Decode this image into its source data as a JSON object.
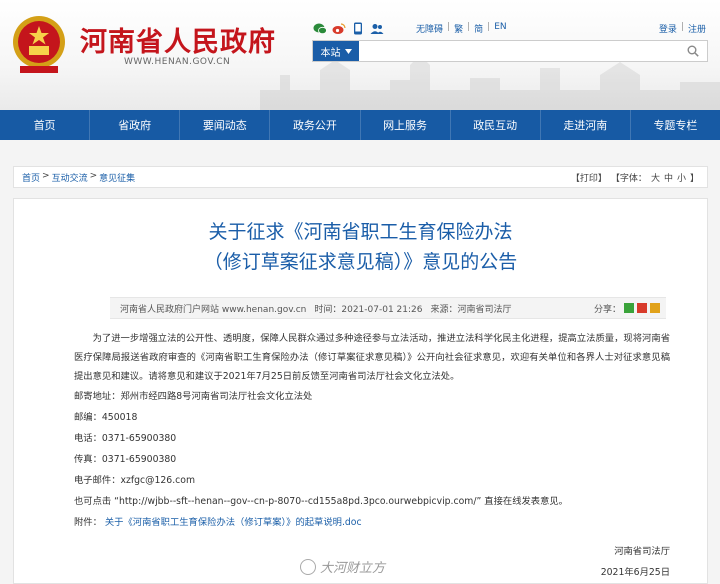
{
  "header": {
    "site_title": "河南省人民政府",
    "site_url": "WWW.HENAN.GOV.CN",
    "icons": [
      "wechat-icon",
      "weibo-icon",
      "mobile-icon",
      "people-icon"
    ],
    "top_links": [
      "无障碍",
      "繁",
      "简",
      "EN"
    ],
    "login": "登录",
    "register": "注册",
    "search": {
      "scope": "本站",
      "placeholder": ""
    }
  },
  "nav": {
    "items": [
      "首页",
      "省政府",
      "要闻动态",
      "政务公开",
      "网上服务",
      "政民互动",
      "走进河南",
      "专题专栏"
    ]
  },
  "breadcrumb": {
    "home": "首页",
    "section": "互动交流",
    "current": "意见征集",
    "print": "【打印】",
    "font_label": "【字体：",
    "font_large": "大",
    "font_medium": "中",
    "font_small": "小",
    "font_end": "】"
  },
  "article": {
    "title_line1": "关于征求《河南省职工生育保险办法",
    "title_line2": "（修订草案征求意见稿）》意见的公告",
    "meta": {
      "publisher": "河南省人民政府门户网站 www.henan.gov.cn",
      "time": "时间：2021-07-01 21:26",
      "source": "来源：河南省司法厅",
      "share_label": "分享："
    },
    "intro": "为了进一步增强立法的公开性、透明度，保障人民群众通过多种途径参与立法活动，推进立法科学化民主化进程，提高立法质量，现将河南省医疗保障局报送省政府审查的《河南省职工生育保险办法（修订草案征求意见稿）》公开向社会征求意见，欢迎有关单位和各界人士对征求意见稿提出意见和建议。请将意见和建议于2021年7月25日前反馈至河南省司法厅社会文化立法处。",
    "address": "邮寄地址：郑州市经四路8号河南省司法厅社会文化立法处",
    "zip": "邮编：450018",
    "phone": "电话：0371-65900380",
    "fax": "传真：0371-65900380",
    "email": "电子邮件：xzfgc@126.com",
    "online_prefix": "也可点击",
    "online_url": "“http://wjbb--sft--henan--gov--cn-p-8070--cd155a8pd.3pco.ourwebpicvip.com/”",
    "online_suffix": "直接在线发表意见。",
    "attachment_label": "附件：",
    "attachment_link": "关于《河南省职工生育保险办法（修订草案）》的起草说明.doc",
    "signature": "河南省司法厅",
    "date": "2021年6月25日"
  },
  "watermark": "大河财立方",
  "colors": {
    "brand_red": "#c4151c",
    "nav_blue": "#175aa4",
    "link_blue": "#1b5fa8"
  }
}
